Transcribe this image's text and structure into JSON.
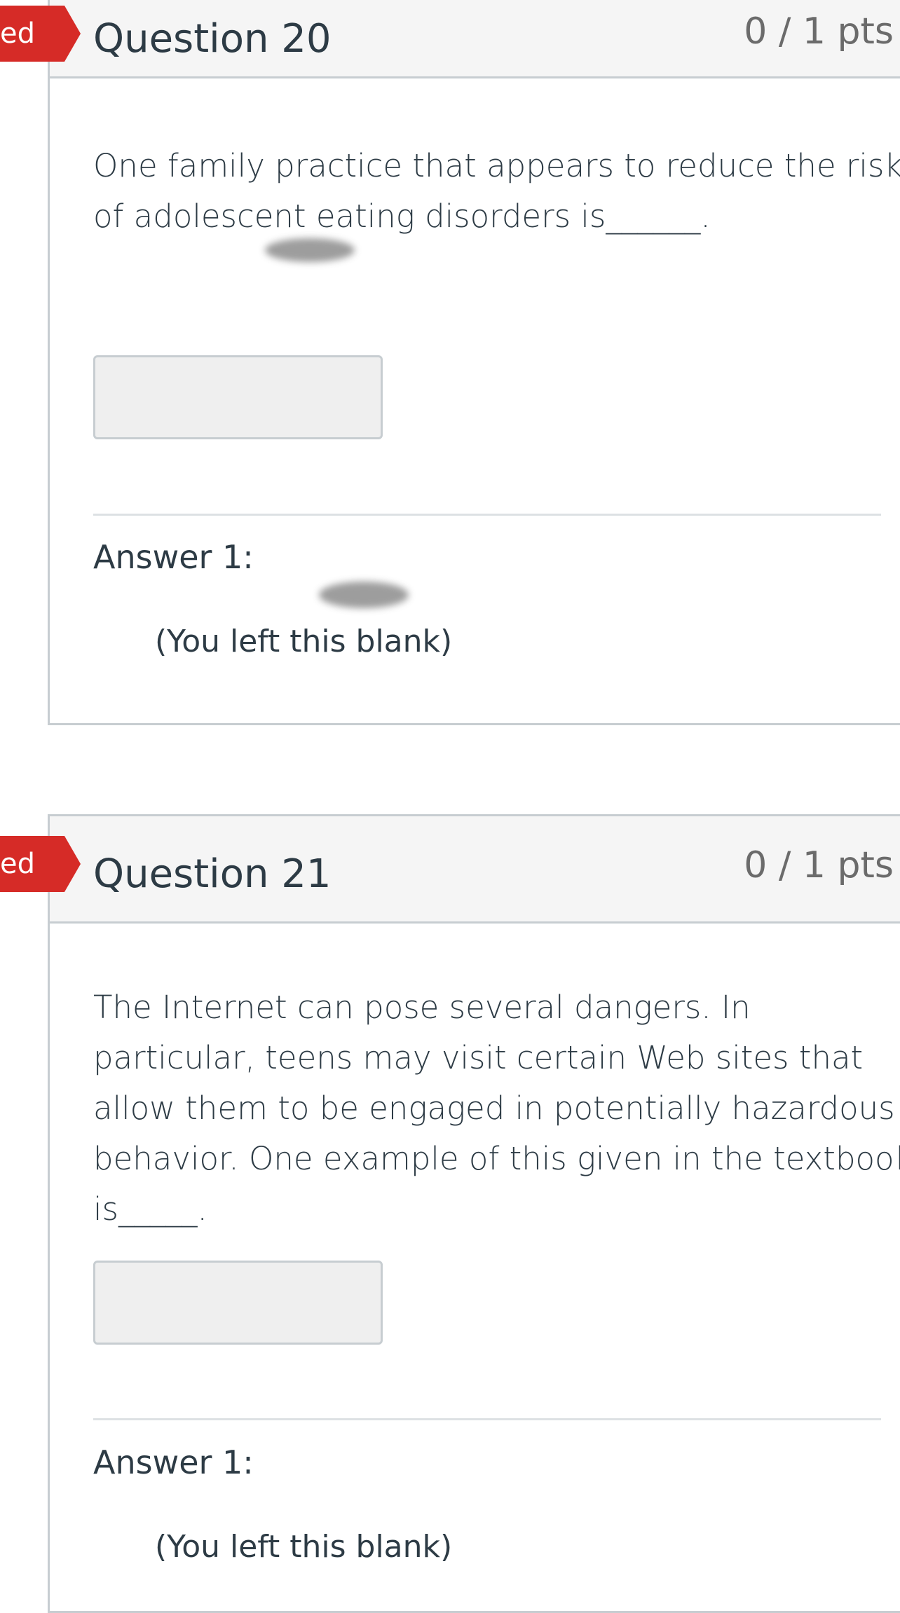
{
  "questions": [
    {
      "flag_label": "ed",
      "title": "Question 20",
      "points": "0 / 1 pts",
      "text": "One family practice that appears to reduce the risk of adolescent eating disorders is______.",
      "answer_label": "Answer 1:",
      "blank_note": "(You left this blank)"
    },
    {
      "flag_label": "ed",
      "title": "Question 21",
      "points": "0 / 1 pts",
      "text": "The Internet can pose several dangers. In particular, teens may visit certain Web sites that allow them to be engaged in potentially hazardous behavior. One example of this given in the textbook is_____.",
      "answer_label": "Answer 1:",
      "blank_note": "(You left this blank)"
    }
  ]
}
